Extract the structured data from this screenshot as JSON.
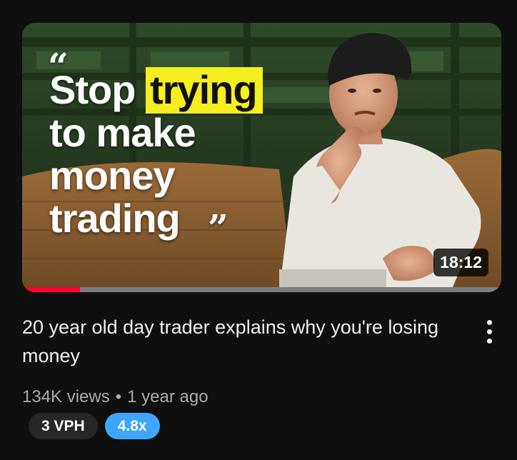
{
  "video": {
    "thumbnail": {
      "quote_open": "“",
      "quote_close": "”",
      "headline_word1": "Stop",
      "headline_highlight": "trying",
      "headline_line2": "to make",
      "headline_line3": "money",
      "headline_line4": "trading",
      "highlight_color": "#f6ee1e",
      "duration": "18:12",
      "watch_progress": 0.12
    },
    "title": "20 year old day trader explains why you're losing money",
    "views": "134K views",
    "separator": "•",
    "age": "1 year ago",
    "menu_icon": "more-vertical-icon",
    "badges": {
      "vph": "3 VPH",
      "multiplier": "4.8x"
    },
    "colors": {
      "background": "#0f0f0f",
      "progress": "#ff0033",
      "multiplier_badge": "#3ea6ff",
      "vph_badge": "#272727"
    }
  }
}
